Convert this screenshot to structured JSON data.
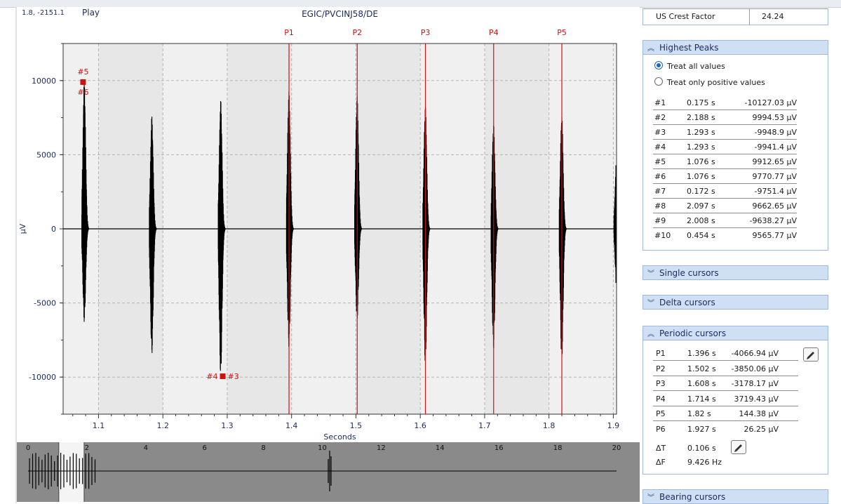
{
  "toolbar": {
    "coords": "1.8, -2151.1",
    "play_label": "Play"
  },
  "plot": {
    "title": "EGIC/PVCINJ58/DE"
  },
  "colors": {
    "waveform": "#000000",
    "cursor": "#cc1111",
    "panel_header": "#cfe0f5",
    "axis_text": "#1b2a5e"
  },
  "chart_data": [
    {
      "type": "line",
      "title": "EGIC/PVCINJ58/DE",
      "xlabel": "Seconds",
      "ylabel": "µV",
      "xlim": [
        1.045,
        1.905
      ],
      "ylim": [
        -12500,
        12500
      ],
      "x_ticks": [
        "1.1",
        "1.2",
        "1.3",
        "1.4",
        "1.5",
        "1.6",
        "1.7",
        "1.8",
        "1.9"
      ],
      "y_ticks": [
        "10000",
        "5000",
        "0",
        "-5000",
        "-10000"
      ],
      "grid": true,
      "bursts": [
        {
          "x": 1.078,
          "max": 10000,
          "min": -6300
        },
        {
          "x": 1.183,
          "max": 7600,
          "min": -8500
        },
        {
          "x": 1.29,
          "max": 8700,
          "min": -10000
        },
        {
          "x": 1.396,
          "max": 9300,
          "min": -8000
        },
        {
          "x": 1.502,
          "max": 9000,
          "min": -6200
        },
        {
          "x": 1.608,
          "max": 8300,
          "min": -9100
        },
        {
          "x": 1.714,
          "max": 7100,
          "min": -8100
        },
        {
          "x": 1.82,
          "max": 7700,
          "min": -8900
        },
        {
          "x": 1.905,
          "max": 4400,
          "min": -3700
        }
      ],
      "periodic_cursors": [
        {
          "label": "P1",
          "x": 1.396
        },
        {
          "label": "P2",
          "x": 1.502
        },
        {
          "label": "P3",
          "x": 1.608
        },
        {
          "label": "P4",
          "x": 1.714
        },
        {
          "label": "P5",
          "x": 1.82
        }
      ],
      "peak_markers": [
        {
          "x": 1.076,
          "y": 9900,
          "labels": [
            "#5",
            "#6"
          ]
        },
        {
          "x": 1.293,
          "y": -9945,
          "labels": [
            "#4",
            "#3"
          ]
        }
      ]
    },
    {
      "type": "line",
      "title": "",
      "xlim": [
        0,
        20
      ],
      "x_ticks": [
        "0",
        "2",
        "4",
        "6",
        "8",
        "10",
        "12",
        "14",
        "16",
        "18",
        "20"
      ],
      "visible_range": [
        1.045,
        1.905
      ],
      "burst_region": [
        0,
        2.3
      ],
      "spike_x": 10.25
    }
  ],
  "panel": {
    "crest": {
      "label": "US Crest Factor",
      "value": "24.24"
    },
    "highest_peaks": {
      "title": "Highest Peaks",
      "options": [
        "Treat all values",
        "Treat only positive values"
      ],
      "selected": 0,
      "rows": [
        [
          "#1",
          "0.175 s",
          "-10127.03 µV"
        ],
        [
          "#2",
          "2.188 s",
          "9994.53 µV"
        ],
        [
          "#3",
          "1.293 s",
          "-9948.9 µV"
        ],
        [
          "#4",
          "1.293 s",
          "-9941.4 µV"
        ],
        [
          "#5",
          "1.076 s",
          "9912.65 µV"
        ],
        [
          "#6",
          "1.076 s",
          "9770.77 µV"
        ],
        [
          "#7",
          "0.172 s",
          "-9751.4 µV"
        ],
        [
          "#8",
          "2.097 s",
          "9662.65 µV"
        ],
        [
          "#9",
          "2.008 s",
          "-9638.27 µV"
        ],
        [
          "#10",
          "0.454 s",
          "9565.77 µV"
        ]
      ]
    },
    "single_cursors": {
      "title": "Single cursors"
    },
    "delta_cursors": {
      "title": "Delta cursors"
    },
    "periodic_cursors": {
      "title": "Periodic cursors",
      "rows": [
        [
          "P1",
          "1.396 s",
          "-4066.94 µV"
        ],
        [
          "P2",
          "1.502 s",
          "-3850.06 µV"
        ],
        [
          "P3",
          "1.608 s",
          "-3178.17 µV"
        ],
        [
          "P4",
          "1.714 s",
          "3719.43 µV"
        ],
        [
          "P5",
          "1.82 s",
          "144.38 µV"
        ],
        [
          "P6",
          "1.927 s",
          "26.25 µV"
        ]
      ],
      "delta_t_label": "ΔT",
      "delta_t_value": "0.106 s",
      "delta_f_label": "ΔF",
      "delta_f_value": "9.426 Hz"
    },
    "bearing_cursors": {
      "title": "Bearing cursors"
    }
  }
}
